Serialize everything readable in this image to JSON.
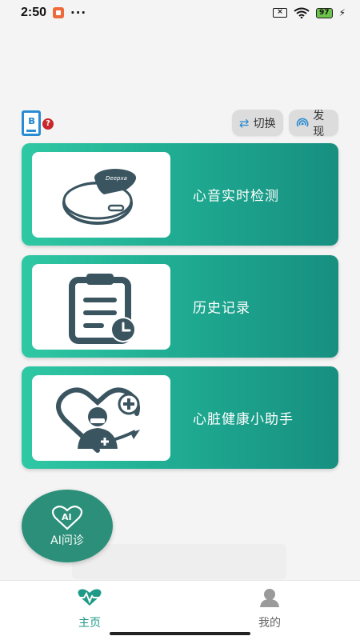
{
  "status_bar": {
    "time": "2:50",
    "dots": "···",
    "battery": "97"
  },
  "toolbar": {
    "switch_label": "切换",
    "discover_label": "发现",
    "badge": "?"
  },
  "cards": [
    {
      "label": "心音实时检测",
      "icon": "stethoscope-device-icon"
    },
    {
      "label": "历史记录",
      "icon": "clipboard-clock-icon"
    },
    {
      "label": "心脏健康小助手",
      "icon": "heart-doctor-icon"
    }
  ],
  "device_brand": "Deepxa",
  "ai_button": {
    "icon_text": "AI",
    "label": "AI问诊"
  },
  "bottom_nav": {
    "home_label": "主页",
    "me_label": "我的"
  },
  "colors": {
    "accent": "#1e9a86",
    "card_start": "#2fc8a4",
    "card_end": "#178f80",
    "bluetooth": "#2a8bd0",
    "badge": "#c9262b"
  }
}
